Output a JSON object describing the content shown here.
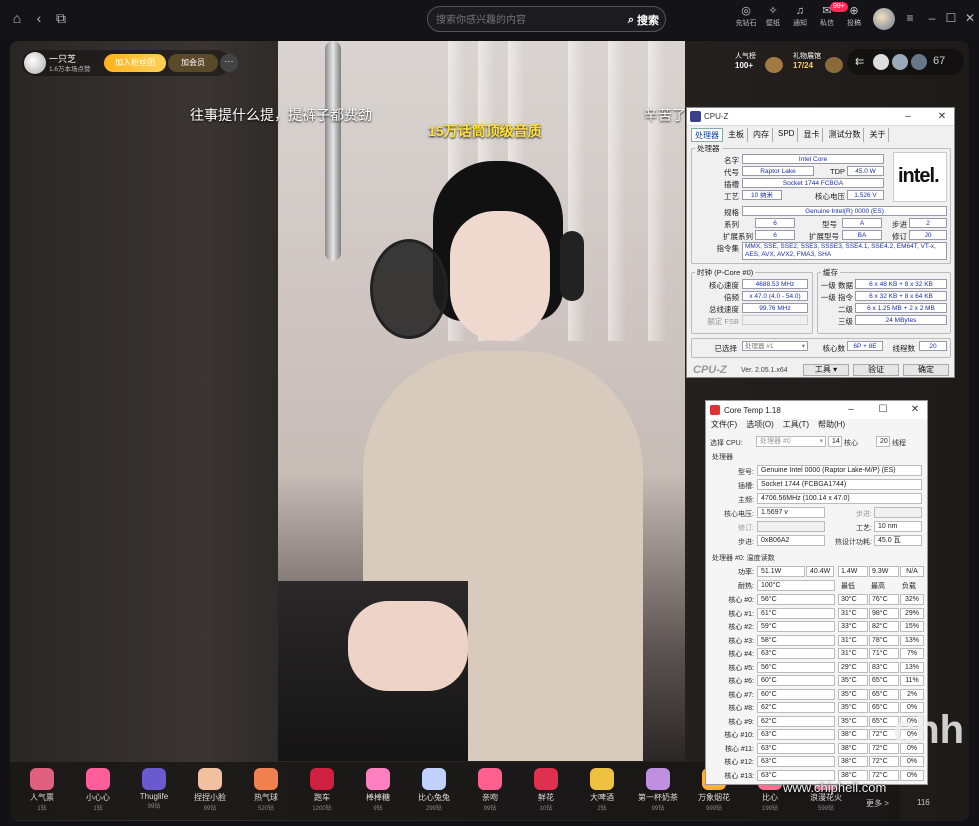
{
  "search": {
    "placeholder": "搜索你感兴趣的内容",
    "button": "搜索"
  },
  "topbar": {
    "items": [
      {
        "label": "充钻石",
        "icon": "diamond-icon"
      },
      {
        "label": "壁纸",
        "icon": "wallpaper-icon"
      },
      {
        "label": "通知",
        "icon": "bell-icon"
      },
      {
        "label": "私信",
        "icon": "message-icon",
        "badge": "99+"
      },
      {
        "label": "投稿",
        "icon": "upload-icon"
      }
    ]
  },
  "streamer": {
    "name": "一只芝",
    "sub": "1.6万本场点赞",
    "fan_button": "加入粉丝团",
    "member_button": "加会员",
    "more": "···"
  },
  "ranks": [
    {
      "label": "人气榜",
      "value": "100+"
    },
    {
      "label": "礼物展馆",
      "value": "17/24"
    }
  ],
  "viewer_count": "67",
  "danmaku": [
    "往事提什么提，提裤子都费劲",
    "辛苦了"
  ],
  "video_title": "15万话筒顶级音质",
  "gifts": [
    {
      "name": "人气票",
      "price": "1钻",
      "color": "#e06080"
    },
    {
      "name": "小心心",
      "price": "1钻",
      "color": "#ff5e9a"
    },
    {
      "name": "Thuglife",
      "price": "99钻",
      "color": "#6a5acd"
    },
    {
      "name": "捏捏小脸",
      "price": "99钻",
      "color": "#f0c0a0"
    },
    {
      "name": "热气球",
      "price": "520钻",
      "color": "#f08050"
    },
    {
      "name": "跑车",
      "price": "1200钻",
      "color": "#d02040"
    },
    {
      "name": "棒棒糖",
      "price": "9钻",
      "color": "#ff80c0"
    },
    {
      "name": "比心兔兔",
      "price": "299钻",
      "color": "#c0d0ff"
    },
    {
      "name": "亲吻",
      "price": "99钻",
      "color": "#ff6090"
    },
    {
      "name": "鲜花",
      "price": "10钻",
      "color": "#e03050"
    },
    {
      "name": "大啤酒",
      "price": "2钻",
      "color": "#f0c040"
    },
    {
      "name": "第一杯奶茶",
      "price": "99钻",
      "color": "#c090e0"
    },
    {
      "name": "万象烟花",
      "price": "999钻",
      "color": "#ffb040"
    },
    {
      "name": "比心",
      "price": "199钻",
      "color": "#ff7090"
    },
    {
      "name": "浪漫花火",
      "price": "599钻",
      "color": "#ff90b0"
    }
  ],
  "gift_more": "更多 >",
  "like_count": "116",
  "cpuz": {
    "title": "CPU-Z",
    "tabs": [
      "处理器",
      "主板",
      "内存",
      "SPD",
      "显卡",
      "测试分数",
      "关于"
    ],
    "processor_group": "处理器",
    "labels": {
      "name": "名字",
      "codename": "代号",
      "tdp": "TDP",
      "package": "插槽",
      "tech": "工艺",
      "voltage": "核心电压",
      "spec": "规格",
      "family": "系列",
      "model": "型号",
      "stepping": "步进",
      "ext_family": "扩展系列",
      "ext_model": "扩展型号",
      "revision": "修订",
      "instructions": "指令集"
    },
    "values": {
      "name": "Intel Core",
      "codename": "Raptor Lake",
      "tdp": "45.0 W",
      "package": "Socket 1744 FCBGA",
      "tech": "10 纳米",
      "voltage": "1.526 V",
      "spec": "Genuine Intel(R) 0000 (ES)",
      "family": "6",
      "model": "A",
      "stepping": "2",
      "ext_family": "6",
      "ext_model": "BA",
      "revision": "J0",
      "instructions": "MMX, SSE, SSE2, SSE3, SSSE3, SSE4.1, SSE4.2, EM64T, VT-x, AES, AVX, AVX2, FMA3, SHA"
    },
    "logo": "intel.",
    "clocks_group": "时钟 (P-Core #0)",
    "clocks": [
      {
        "label": "核心速度",
        "value": "4688.53 MHz"
      },
      {
        "label": "倍频",
        "value": "x 47.0 (4.0 - 54.0)"
      },
      {
        "label": "总线速度",
        "value": "99.76 MHz"
      },
      {
        "label": "额定 FSB",
        "value": ""
      }
    ],
    "cache_group": "缓存",
    "cache": [
      {
        "label": "一级 数据",
        "value": "6 x 48 KB + 8 x 32 KB"
      },
      {
        "label": "一级 指令",
        "value": "6 x 32 KB + 8 x 64 KB"
      },
      {
        "label": "二级",
        "value": "6 x 1.25 MB + 2 x 2 MB"
      },
      {
        "label": "三级",
        "value": "24 MBytes"
      }
    ],
    "selection_label": "已选择",
    "selection_value": "处理器 #1",
    "cores_label": "核心数",
    "cores_value": "6P + 8E",
    "threads_label": "线程数",
    "threads_value": "20",
    "brand": "CPU-Z",
    "version": "Ver. 2.05.1.x64",
    "tools_button": "工具",
    "validate_button": "验证",
    "ok_button": "确定"
  },
  "coretemp": {
    "title": "Core Temp 1.18",
    "menu": [
      "文件(F)",
      "选项(O)",
      "工具(T)",
      "帮助(H)"
    ],
    "select_cpu_label": "选择 CPU:",
    "select_cpu_value": "处理器 #0",
    "cores_num": "14",
    "cores_label": "核心",
    "threads_num": "20",
    "threads_label": "线程",
    "processor_group": "处理器",
    "model_label": "型号:",
    "model_value": "Genuine Intel 0000 (Raptor Lake-M/P) (ES)",
    "platform_label": "插槽:",
    "platform_value": "Socket 1744 (FCBGA1744)",
    "freq_label": "主频:",
    "freq_value": "4706.56MHz (100.14 x 47.0)",
    "vid_label": "核心电压:",
    "vid_value": "1.5697 v",
    "mod_label": "步进:",
    "revision_label": "修订:",
    "lith_label": "工艺:",
    "lith_value": "10 nm",
    "cpuid_label": "步进:",
    "cpuid_value": "0xB06A2",
    "tdp_label": "热设计功耗:",
    "tdp_value": "45.0 瓦",
    "temp_group": "处理器 #0: 温度读数",
    "power_label": "功率:",
    "power_values": [
      "51.1W",
      "40.4W",
      "1.4W",
      "9.3W",
      "N/A"
    ],
    "tjmax_label": "耐热:",
    "tjmax_value": "100°C",
    "headers": [
      "最低",
      "最高",
      "负载"
    ],
    "cores": [
      {
        "label": "核心 #0:",
        "temp": "56°C",
        "min": "30°C",
        "max": "76°C",
        "load": "32%"
      },
      {
        "label": "核心 #1:",
        "temp": "61°C",
        "min": "31°C",
        "max": "98°C",
        "load": "29%"
      },
      {
        "label": "核心 #2:",
        "temp": "59°C",
        "min": "33°C",
        "max": "82°C",
        "load": "15%"
      },
      {
        "label": "核心 #3:",
        "temp": "58°C",
        "min": "31°C",
        "max": "78°C",
        "load": "13%"
      },
      {
        "label": "核心 #4:",
        "temp": "63°C",
        "min": "31°C",
        "max": "71°C",
        "load": "7%"
      },
      {
        "label": "核心 #5:",
        "temp": "56°C",
        "min": "29°C",
        "max": "83°C",
        "load": "13%"
      },
      {
        "label": "核心 #6:",
        "temp": "60°C",
        "min": "35°C",
        "max": "65°C",
        "load": "11%"
      },
      {
        "label": "核心 #7:",
        "temp": "60°C",
        "min": "35°C",
        "max": "65°C",
        "load": "2%"
      },
      {
        "label": "核心 #8:",
        "temp": "62°C",
        "min": "35°C",
        "max": "65°C",
        "load": "0%"
      },
      {
        "label": "核心 #9:",
        "temp": "62°C",
        "min": "35°C",
        "max": "65°C",
        "load": "0%"
      },
      {
        "label": "核心 #10:",
        "temp": "63°C",
        "min": "38°C",
        "max": "72°C",
        "load": "0%"
      },
      {
        "label": "核心 #11:",
        "temp": "63°C",
        "min": "38°C",
        "max": "72°C",
        "load": "0%"
      },
      {
        "label": "核心 #12:",
        "temp": "63°C",
        "min": "38°C",
        "max": "72°C",
        "load": "0%"
      },
      {
        "label": "核心 #13:",
        "temp": "63°C",
        "min": "38°C",
        "max": "72°C",
        "load": "0%"
      }
    ]
  },
  "watermark": "www.chiphell.com",
  "chh_logo": "chh"
}
